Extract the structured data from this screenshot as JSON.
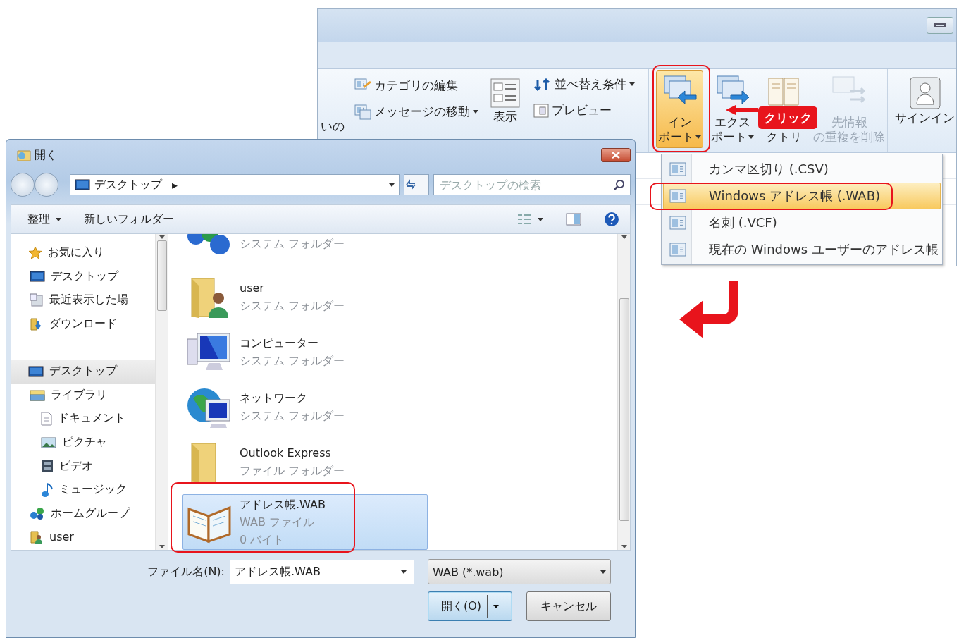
{
  "ribbon_window": {
    "cut_label": "いの",
    "small_buttons": [
      {
        "label": "カテゴリの編集",
        "dropdown": false
      },
      {
        "label": "メッセージの移動",
        "dropdown": true
      }
    ],
    "view_button": {
      "label": "表示"
    },
    "sort_buttons": [
      {
        "label": "並べ替え条件",
        "dropdown": true
      },
      {
        "label": "プレビュー",
        "dropdown": false
      }
    ],
    "large_buttons": [
      {
        "lines": [
          "イン",
          "ポート"
        ],
        "dropdown": true,
        "selected": true,
        "disabled": false
      },
      {
        "lines": [
          "エクス",
          "ポート"
        ],
        "dropdown": true,
        "selected": false,
        "disabled": false
      },
      {
        "lines": [
          "クトリ"
        ],
        "dropdown": false,
        "selected": false,
        "disabled": false
      },
      {
        "lines": [
          "先情報",
          "の重複を削除"
        ],
        "dropdown": false,
        "selected": false,
        "disabled": true
      }
    ],
    "signin": {
      "label": "サインイン"
    }
  },
  "import_menu": {
    "items": [
      {
        "label": "カンマ区切り (.CSV)",
        "selected": false
      },
      {
        "label": "Windows アドレス帳 (.WAB)",
        "selected": true
      },
      {
        "label": "名刺 (.VCF)",
        "selected": false
      },
      {
        "label": "現在の Windows ユーザーのアドレス帳",
        "selected": false
      }
    ]
  },
  "callout": {
    "text": "クリック"
  },
  "dialog": {
    "title": "開く",
    "address": "デスクトップ",
    "address_arrow": "▸",
    "search": {
      "placeholder": "デスクトップの検索"
    },
    "toolbar": {
      "organize": "整理",
      "new_folder": "新しいフォルダー"
    },
    "nav_tree": [
      {
        "label": "お気に入り",
        "selected": false,
        "children": [
          {
            "label": "デスクトップ",
            "selected": false
          },
          {
            "label": "最近表示した場",
            "selected": false
          },
          {
            "label": "ダウンロード",
            "selected": false
          }
        ]
      },
      {
        "label": "デスクトップ",
        "selected": true,
        "children": [
          {
            "label": "ライブラリ",
            "selected": false,
            "children": [
              {
                "label": "ドキュメント",
                "selected": false
              },
              {
                "label": "ピクチャ",
                "selected": false
              },
              {
                "label": "ビデオ",
                "selected": false
              },
              {
                "label": "ミュージック",
                "selected": false
              }
            ]
          },
          {
            "label": "ホームグループ",
            "selected": false
          },
          {
            "label": "user",
            "selected": false
          }
        ]
      }
    ],
    "files": [
      {
        "details": [
          "システム フォルダー"
        ],
        "selected": false
      },
      {
        "name": "user",
        "details": [
          "システム フォルダー"
        ],
        "selected": false
      },
      {
        "name": "コンピューター",
        "details": [
          "システム フォルダー"
        ],
        "selected": false
      },
      {
        "name": "ネットワーク",
        "details": [
          "システム フォルダー"
        ],
        "selected": false
      },
      {
        "name": "Outlook Express",
        "details": [
          "ファイル フォルダー"
        ],
        "selected": false
      },
      {
        "name": "アドレス帳.WAB",
        "details": [
          "WAB ファイル",
          "0 バイト"
        ],
        "selected": true
      }
    ],
    "file_name_label": "ファイル名(N):",
    "file_name": "アドレス帳.WAB",
    "file_type": "WAB (*.wab)",
    "buttons": [
      {
        "label": "開く(O)",
        "kind": "split"
      },
      {
        "label": "キャンセル",
        "kind": "plain"
      }
    ]
  }
}
